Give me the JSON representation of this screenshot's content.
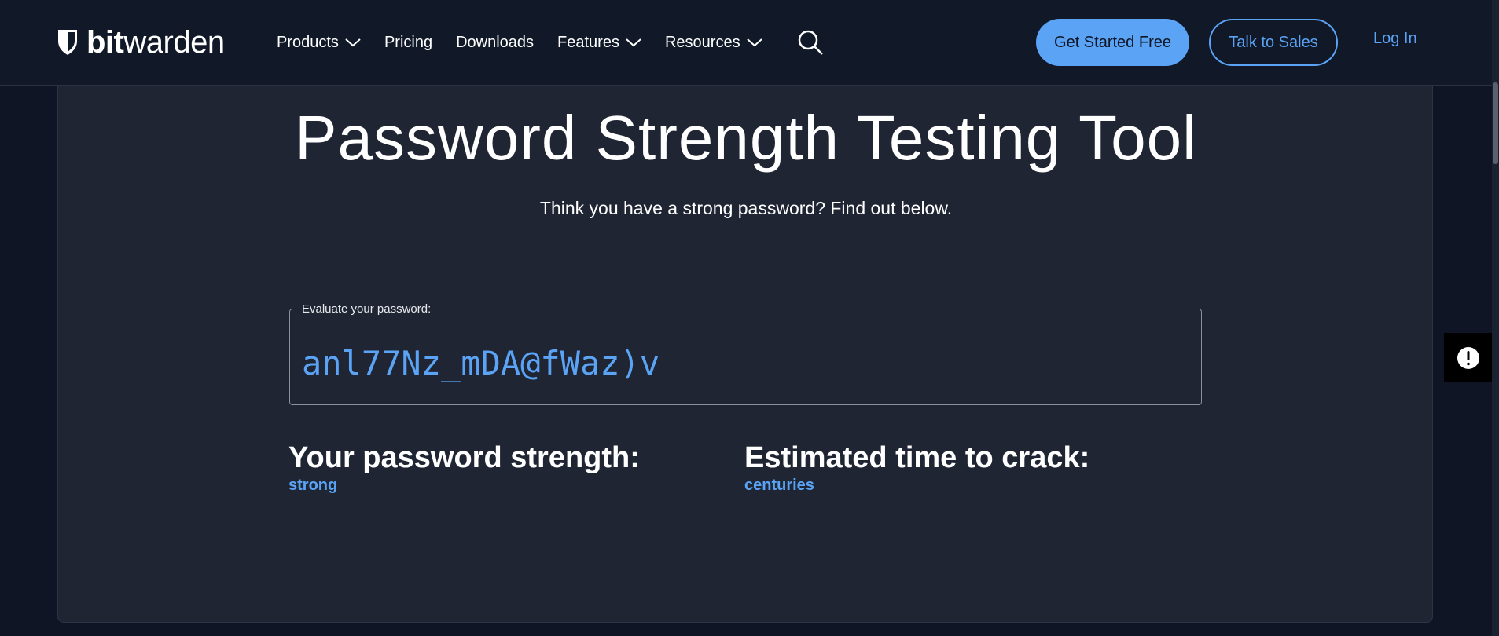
{
  "brand": {
    "name_bold": "bit",
    "name_light": "warden",
    "logo_icon": "shield-icon"
  },
  "nav": {
    "items": [
      {
        "label": "Products",
        "has_dropdown": true
      },
      {
        "label": "Pricing",
        "has_dropdown": false
      },
      {
        "label": "Downloads",
        "has_dropdown": false
      },
      {
        "label": "Features",
        "has_dropdown": true
      },
      {
        "label": "Resources",
        "has_dropdown": true
      }
    ],
    "search_icon": "search-icon",
    "cta_primary": "Get Started Free",
    "cta_secondary": "Talk to Sales",
    "login": "Log In"
  },
  "hero": {
    "title": "Password Strength Testing Tool",
    "subtitle": "Think you have a strong password? Find out below."
  },
  "evaluator": {
    "legend": "Evaluate your password:",
    "value": "anl77Nz_mDA@fWaz)v"
  },
  "results": {
    "strength_label": "Your password strength:",
    "strength_value": "strong",
    "crack_label": "Estimated time to crack:",
    "crack_value": "centuries"
  },
  "feedback": {
    "icon": "feedback-icon"
  },
  "colors": {
    "accent": "#5aa3f5",
    "nav_bg": "#111827",
    "page_bg": "#0f1524",
    "card_bg": "#1f2533"
  }
}
